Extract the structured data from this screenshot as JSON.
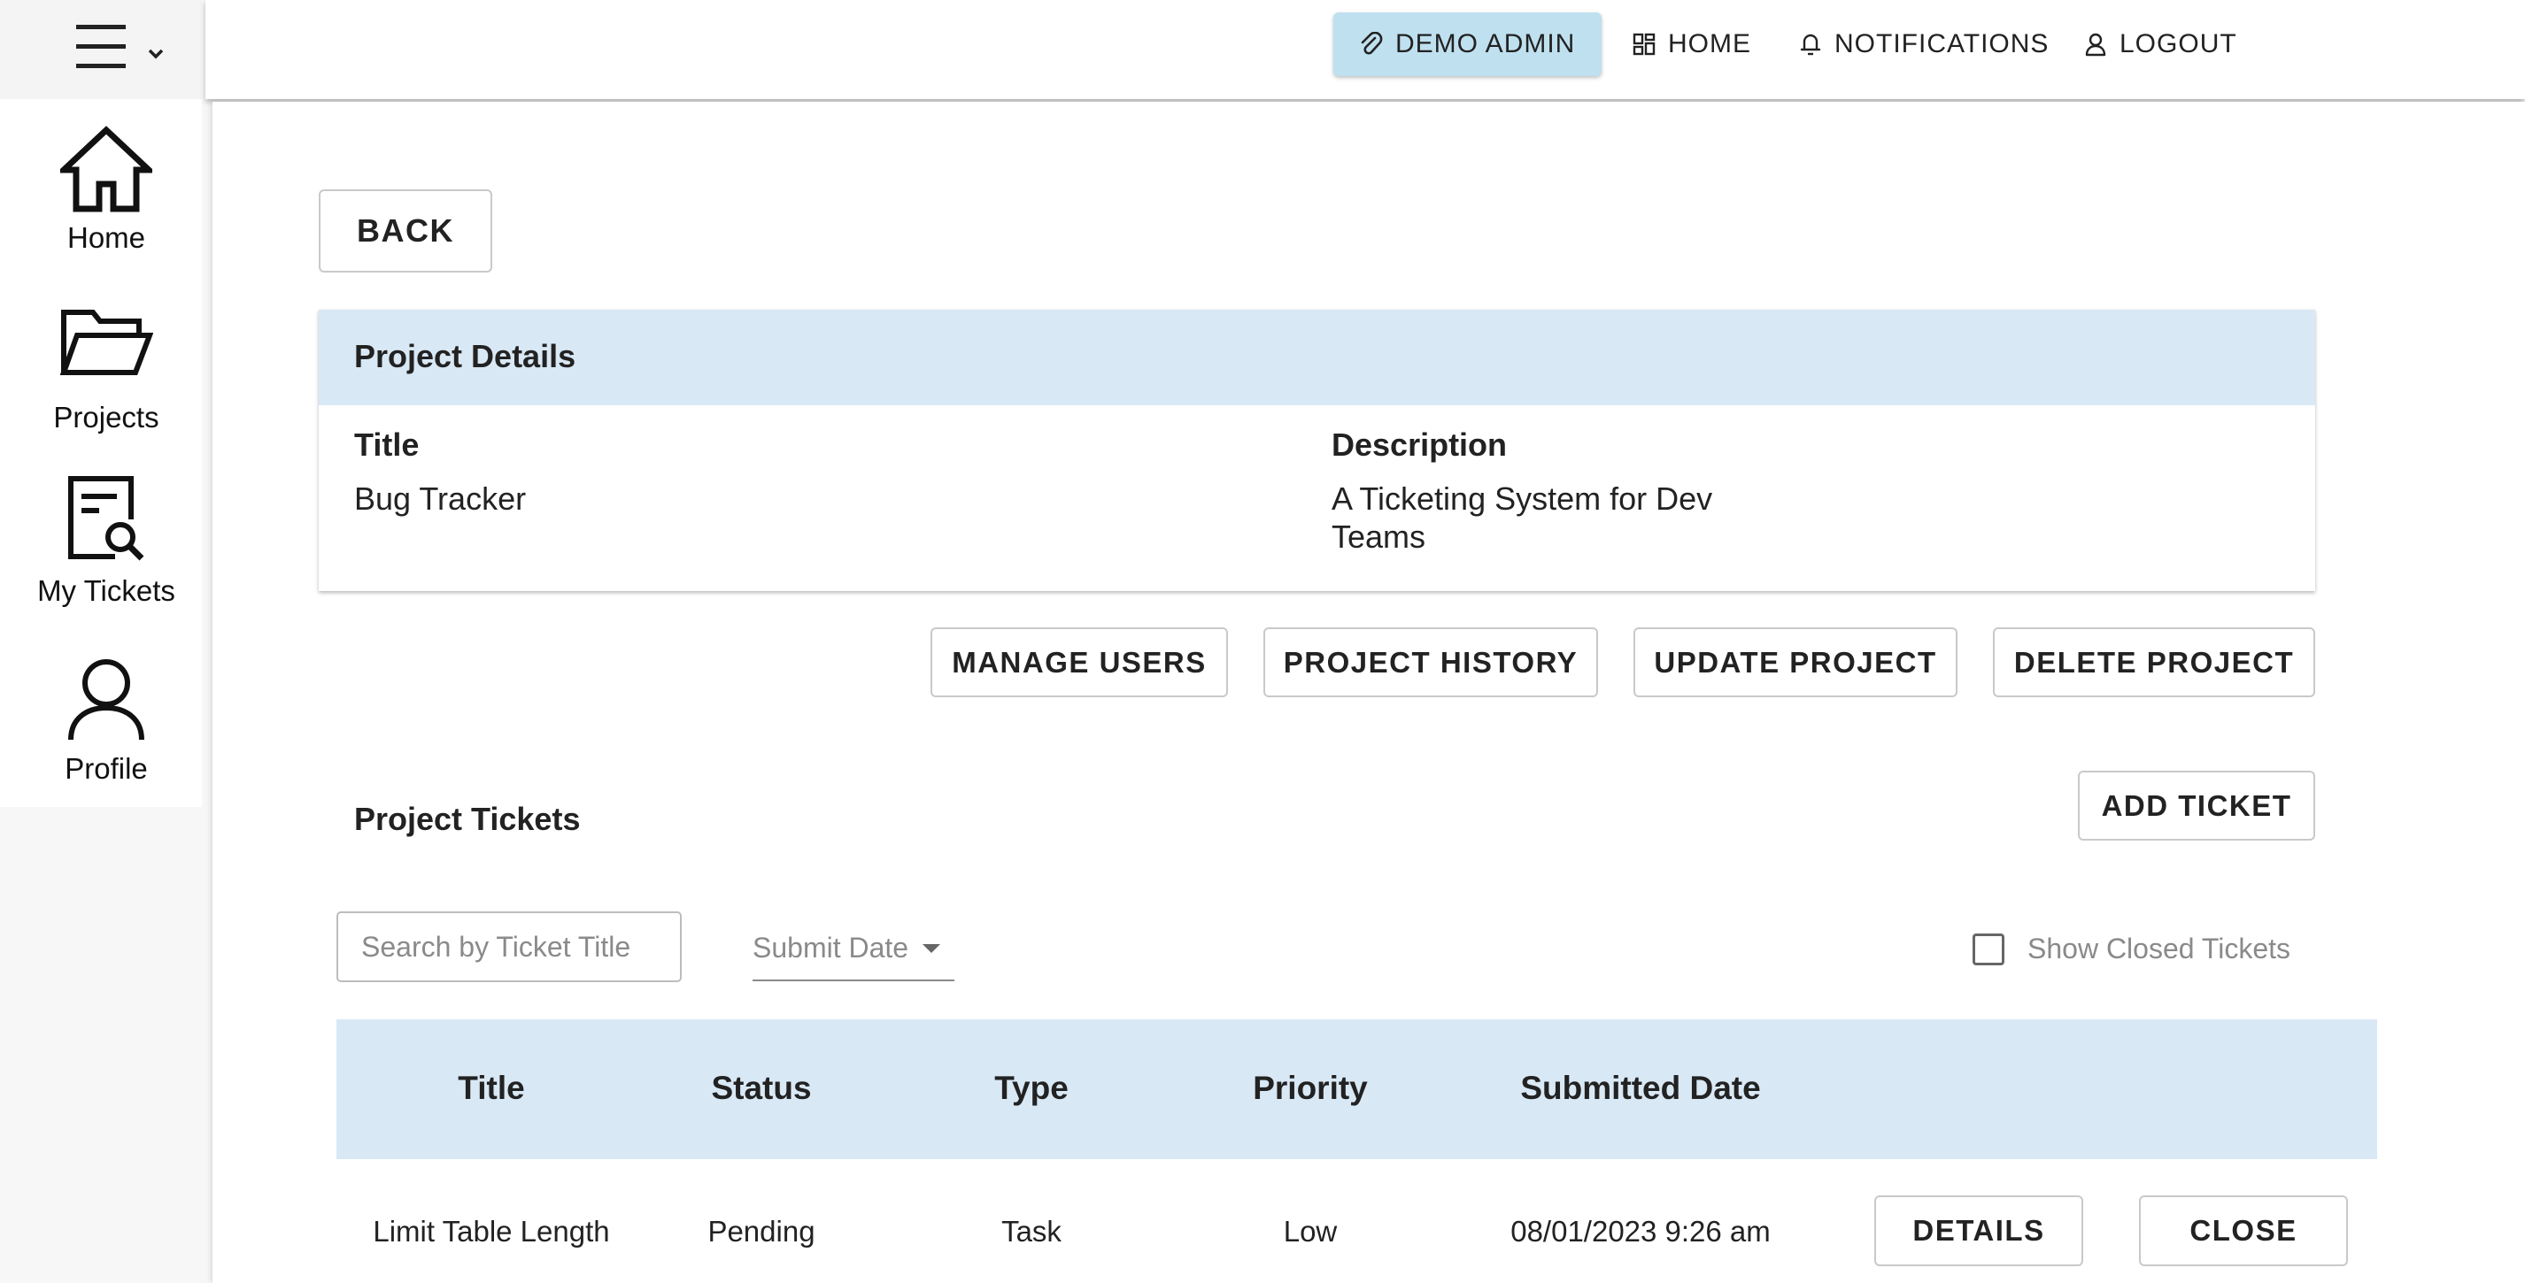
{
  "sidebar": {
    "items": [
      {
        "label": "Home",
        "icon": "home-icon"
      },
      {
        "label": "Projects",
        "icon": "folder-open-icon"
      },
      {
        "label": "My Tickets",
        "icon": "ticket-search-icon"
      },
      {
        "label": "Profile",
        "icon": "user-icon"
      }
    ]
  },
  "topbar": {
    "user_label": "DEMO ADMIN",
    "home_label": "HOME",
    "notifications_label": "NOTIFICATIONS",
    "logout_label": "LOGOUT"
  },
  "main": {
    "back_label": "BACK",
    "project_details": {
      "header": "Project Details",
      "title_label": "Title",
      "title_value": "Bug Tracker",
      "description_label": "Description",
      "description_line1": "A Ticketing System for Dev",
      "description_line2": "Teams"
    },
    "actions": {
      "manage_users": "MANAGE USERS",
      "project_history": "PROJECT HISTORY",
      "update_project": "UPDATE PROJECT",
      "delete_project": "DELETE PROJECT"
    },
    "tickets": {
      "section_title": "Project Tickets",
      "add_ticket": "ADD TICKET",
      "search_placeholder": "Search by Ticket Title",
      "sort_value": "Submit Date",
      "show_closed_label": "Show Closed Tickets",
      "show_closed_checked": false,
      "columns": [
        "Title",
        "Status",
        "Type",
        "Priority",
        "Submitted Date"
      ],
      "rows": [
        {
          "cells": [
            "Limit Table Length",
            "Pending",
            "Task",
            "Low",
            "08/01/2023 9:26 am"
          ],
          "details_label": "DETAILS",
          "close_label": "CLOSE"
        }
      ]
    }
  },
  "colors": {
    "accent_light_blue": "#d9e8f5",
    "active_button_blue": "#bfe0ef",
    "text_dark": "#222222",
    "placeholder_gray": "#8a8a8a"
  }
}
